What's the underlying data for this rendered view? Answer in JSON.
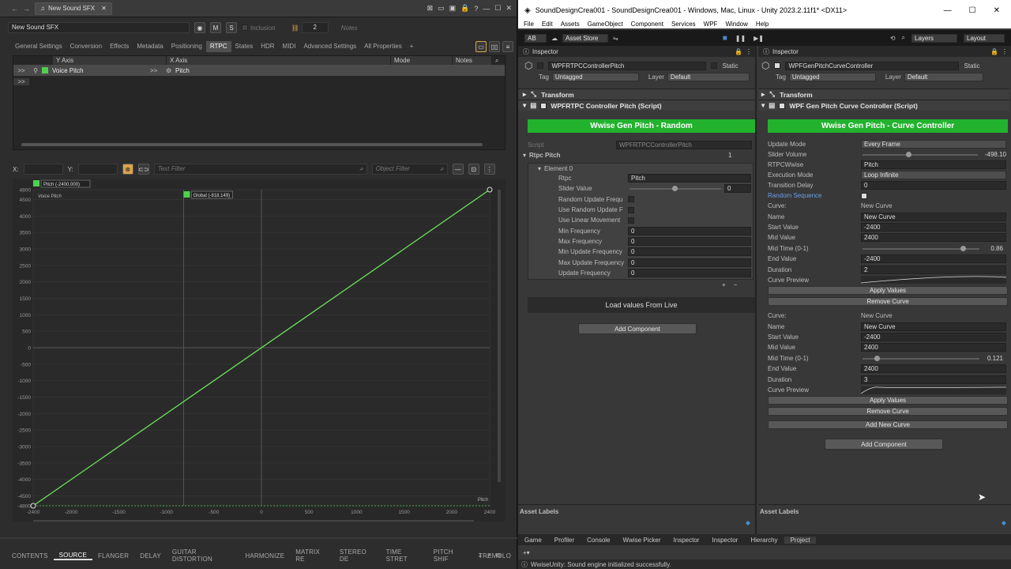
{
  "wwise": {
    "tab_title": "New Sound SFX",
    "object_name": "New Sound SFX",
    "mute_label": "M",
    "solo_label": "S",
    "inclusion_label": "Inclusion",
    "count": "2",
    "notes_placeholder": "Notes",
    "tabs": [
      "General Settings",
      "Conversion",
      "Effects",
      "Metadata",
      "Positioning",
      "RTPC",
      "States",
      "HDR",
      "MIDI",
      "Advanced Settings",
      "All Properties",
      "+"
    ],
    "active_tab": "RTPC",
    "table_headers": {
      "y_axis": "Y Axis",
      "x_axis": "X Axis",
      "mode": "Mode",
      "notes": "Notes"
    },
    "rtpc_row": {
      "expand": ">>",
      "y_axis": "Voice Pitch",
      "x_expand": ">>",
      "x_axis": "Pitch"
    },
    "empty_row_expand": ">>",
    "graph_toolbar": {
      "x_label": "X:",
      "y_label": "Y:",
      "text_filter_placeholder": "Text Filter",
      "object_filter_placeholder": "Object Filter"
    },
    "graph": {
      "point_label_left": "Pitch (-2400.000)",
      "point_label_mid": "Global (-818.149)",
      "series_label": "Voice Pitch",
      "x_axis_name": "Pitch",
      "y_ticks": [
        "4800",
        "4500",
        "4000",
        "3500",
        "3000",
        "2500",
        "2000",
        "1500",
        "1000",
        "500",
        "0",
        "-500",
        "-1000",
        "-1500",
        "-2000",
        "-2500",
        "-3000",
        "-3500",
        "-4000",
        "-4500",
        "-4800"
      ],
      "x_ticks": [
        "-2400",
        "-2000",
        "-1500",
        "-1000",
        "-500",
        "0",
        "500",
        "1000",
        "1500",
        "2000",
        "2400"
      ]
    },
    "bottom_tabs": [
      "CONTENTS",
      "SOURCE",
      "FLANGER",
      "DELAY",
      "GUITAR DISTORTION",
      "HARMONIZE",
      "MATRIX RE",
      "STEREO DE",
      "TIME STRET",
      "PITCH SHIF",
      "TREMOLO"
    ],
    "active_bottom_tab": "SOURCE"
  },
  "chart_data": {
    "type": "line",
    "series": [
      {
        "name": "Voice Pitch",
        "x": [
          -2400,
          2400
        ],
        "y": [
          -4800,
          4800
        ]
      }
    ],
    "xlabel": "Pitch",
    "xlim": [
      -2400,
      2400
    ],
    "ylim": [
      -4800,
      4800
    ],
    "grid": true
  },
  "unity": {
    "window_title": "SoundDesignCrea001 - SoundDesignCrea001 - Windows, Mac, Linux - Unity 2023.2.11f1* <DX11>",
    "menu": [
      "File",
      "Edit",
      "Assets",
      "GameObject",
      "Component",
      "Services",
      "WPF",
      "Window",
      "Help"
    ],
    "account": "AB",
    "asset_store": "Asset Store",
    "layers": "Layers",
    "layout": "Layout",
    "left_inspector": {
      "tab": "Inspector",
      "object_name": "WPFRTPCControllerPitch",
      "static_label": "Static",
      "tag_label": "Tag",
      "tag_value": "Untagged",
      "layer_label": "Layer",
      "layer_value": "Default",
      "transform": "Transform",
      "script_header": "WPFRTPC Controller Pitch (Script)",
      "green_button": "Wwise Gen Pitch - Random",
      "script_label": "Script",
      "script_value": "WPFRTPCControllerPitch",
      "rtpc_pitch_label": "Rtpc Pitch",
      "rtpc_pitch_count": "1",
      "element": "Element 0",
      "fields": [
        {
          "label": "Rtpc",
          "value": "Pitch"
        },
        {
          "label": "Slider Value",
          "value": "0"
        },
        {
          "label": "Random Update Frequ",
          "value": ""
        },
        {
          "label": "Use Random Update F",
          "value": ""
        },
        {
          "label": "Use Linear Movement",
          "value": ""
        },
        {
          "label": "Min Frequency",
          "value": "0"
        },
        {
          "label": "Max Frequency",
          "value": "0"
        },
        {
          "label": "Min Update Frequency",
          "value": "0"
        },
        {
          "label": "Max Update Frequency",
          "value": "0"
        },
        {
          "label": "Update Frequency",
          "value": "0"
        }
      ],
      "plus": "+",
      "minus": "−",
      "load_button": "Load values From Live",
      "add_component": "Add Component",
      "asset_labels": "Asset Labels"
    },
    "right_inspector": {
      "tab": "Inspector",
      "object_name": "WPFGenPitchCurveController",
      "static_label": "Static",
      "tag_label": "Tag",
      "tag_value": "Untagged",
      "layer_label": "Layer",
      "layer_value": "Default",
      "transform": "Transform",
      "script_header": "WPF Gen Pitch Curve Controller (Script)",
      "green_button": "Wwise Gen Pitch - Curve Controller",
      "update_mode_label": "Update Mode",
      "update_mode_value": "Every Frame",
      "slider_volume_label": "Slider Volume",
      "slider_volume_value": "-498.10",
      "slider_volume_fraction": 0.4,
      "rtpc_label": "RTPCWwise",
      "rtpc_value": "Pitch",
      "exec_label": "Execution Mode",
      "exec_value": "Loop Infinite",
      "transition_label": "Transition Delay",
      "transition_value": "0",
      "random_seq_label": "Random Sequence",
      "curves": [
        {
          "curve_label": "Curve:",
          "curve_value": "New Curve",
          "name_label": "Name",
          "name_value": "New Curve",
          "start_label": "Start Value",
          "start_value": "-2400",
          "mid_label": "Mid Value",
          "mid_value": "2400",
          "midtime_label": "Mid Time (0-1)",
          "midtime_value": "0.86",
          "midtime_fraction": 0.86,
          "end_label": "End Value",
          "end_value": "-2400",
          "duration_label": "Duration",
          "duration_value": "2",
          "preview_label": "Curve Preview",
          "apply": "Apply Values",
          "remove": "Remove Curve"
        },
        {
          "curve_label": "Curve:",
          "curve_value": "New Curve",
          "name_label": "Name",
          "name_value": "New Curve",
          "start_label": "Start Value",
          "start_value": "-2400",
          "mid_label": "Mid Value",
          "mid_value": "2400",
          "midtime_label": "Mid Time (0-1)",
          "midtime_value": "0.121",
          "midtime_fraction": 0.121,
          "end_label": "End Value",
          "end_value": "2400",
          "duration_label": "Duration",
          "duration_value": "3",
          "preview_label": "Curve Preview",
          "apply": "Apply Values",
          "remove": "Remove Curve"
        }
      ],
      "add_new_curve": "Add New Curve",
      "add_component": "Add Component",
      "asset_labels": "Asset Labels"
    },
    "bottom_tabs": [
      "Game",
      "Profiler",
      "Console",
      "Wwise Picker",
      "Inspector",
      "Inspector",
      "Hierarchy",
      "Project"
    ],
    "status": "WwiseUnity: Sound engine initialized successfully.",
    "colors": {
      "green": "#22b22e",
      "accent_blue": "#4a8ad6"
    }
  }
}
